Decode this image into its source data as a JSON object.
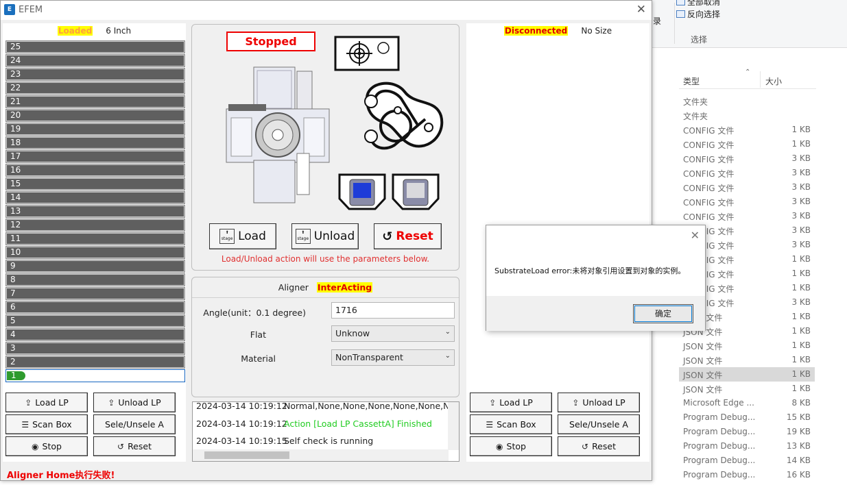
{
  "explorer": {
    "ribbon": {
      "select_all": "全部取消",
      "invert_selection": "反向选择",
      "group_label": "选择",
      "left_text": "录"
    },
    "columns": {
      "type": "类型",
      "size": "大小"
    },
    "rows": [
      {
        "type": "文件夹",
        "size": ""
      },
      {
        "type": "文件夹",
        "size": ""
      },
      {
        "type": "CONFIG 文件",
        "size": "1 KB"
      },
      {
        "type": "CONFIG 文件",
        "size": "1 KB"
      },
      {
        "type": "CONFIG 文件",
        "size": "3 KB"
      },
      {
        "type": "CONFIG 文件",
        "size": "3 KB"
      },
      {
        "type": "CONFIG 文件",
        "size": "3 KB"
      },
      {
        "type": "CONFIG 文件",
        "size": "3 KB"
      },
      {
        "type": "CONFIG 文件",
        "size": "3 KB"
      },
      {
        "type": "CONFIG 文件",
        "size": "3 KB"
      },
      {
        "type": "CONFIG 文件",
        "size": "3 KB"
      },
      {
        "type": "CONFIG 文件",
        "size": "1 KB"
      },
      {
        "type": "CONFIG 文件",
        "size": "1 KB"
      },
      {
        "type": "CONFIG 文件",
        "size": "1 KB"
      },
      {
        "type": "CONFIG 文件",
        "size": "3 KB"
      },
      {
        "type": "JSON 文件",
        "size": "1 KB"
      },
      {
        "type": "JSON 文件",
        "size": "1 KB"
      },
      {
        "type": "JSON 文件",
        "size": "1 KB"
      },
      {
        "type": "JSON 文件",
        "size": "1 KB"
      },
      {
        "type": "JSON 文件",
        "size": "1 KB",
        "selected": true
      },
      {
        "type": "JSON 文件",
        "size": "1 KB"
      },
      {
        "type": "Microsoft Edge ...",
        "size": "8 KB"
      },
      {
        "type": "Program Debug...",
        "size": "15 KB"
      },
      {
        "type": "Program Debug...",
        "size": "19 KB"
      },
      {
        "type": "Program Debug...",
        "size": "13 KB"
      },
      {
        "type": "Program Debug...",
        "size": "14 KB"
      },
      {
        "type": "Program Debug...",
        "size": "16 KB"
      }
    ]
  },
  "window": {
    "title": "EFEM",
    "icon_text": "E"
  },
  "left_port": {
    "status": "Loaded",
    "size": "6 Inch",
    "slots": [
      "25",
      "24",
      "23",
      "22",
      "21",
      "20",
      "19",
      "18",
      "17",
      "16",
      "15",
      "14",
      "13",
      "12",
      "11",
      "10",
      "9",
      "8",
      "7",
      "6",
      "5",
      "4",
      "3",
      "2",
      "1"
    ],
    "loaded_slot": "1",
    "buttons": {
      "load": "Load LP",
      "unload": "Unload LP",
      "scan": "Scan Box",
      "select": "Sele/Unsele A",
      "stop": "Stop",
      "reset": "Reset"
    }
  },
  "right_port": {
    "status": "Disconnected",
    "size": "No Size",
    "buttons": {
      "load": "Load LP",
      "unload": "Unload LP",
      "scan": "Scan Box",
      "select": "Sele/Unsele A",
      "stop": "Stop",
      "reset": "Reset"
    }
  },
  "robot": {
    "status": "Stopped",
    "load": "Load",
    "unload": "Unload",
    "reset": "Reset",
    "stage_label": "stage",
    "hint": "Load/Unload action will use the parameters below."
  },
  "aligner": {
    "label": "Aligner",
    "status": "InterActing",
    "angle_label": "Angle(unit：0.1 degree)",
    "angle_value": "1716",
    "flat_label": "Flat",
    "flat_value": "Unknow",
    "material_label": "Material",
    "material_value": "NonTransparent"
  },
  "log": [
    {
      "time": "2024-03-14 10:19:12",
      "msg": "Normal,None,None,None,None,None,Nor"
    },
    {
      "time": "2024-03-14 10:19:12",
      "msg": "Action [Load LP CassettA] Finished",
      "green": true
    },
    {
      "time": "2024-03-14 10:19:15",
      "msg": "Self check is running"
    }
  ],
  "status_message": "Aligner Home执行失败!",
  "dialog": {
    "message": "SubstrateLoad error:未将对象引用设置到对象的实例。",
    "ok": "确定"
  },
  "colors": {
    "highlight": "#ffff00",
    "loaded_text": "#ffa040",
    "error_red": "#e00000",
    "slot_gray": "#5f5f5f",
    "wafer_green": "#2e9b2e"
  }
}
